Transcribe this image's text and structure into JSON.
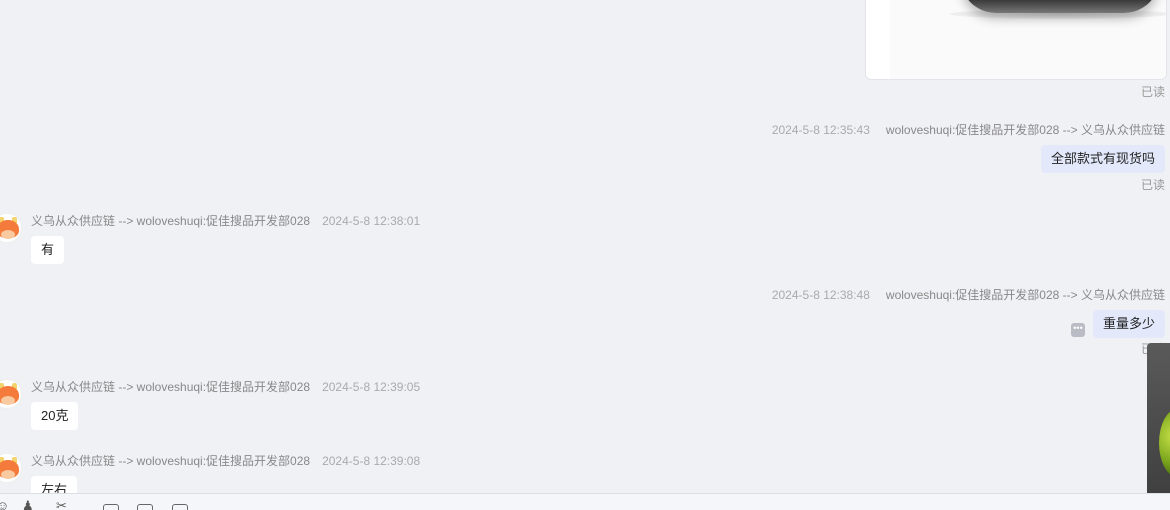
{
  "messages": {
    "m0": {
      "read": "已读"
    },
    "m1": {
      "time": "2024-5-8 12:35:43",
      "from_to": "woloveshuqi:促佳搜品开发部028 --> 义乌从众供应链",
      "text": "全部款式有现货吗",
      "read": "已读"
    },
    "m2": {
      "from_to": "义乌从众供应链 --> woloveshuqi:促佳搜品开发部028",
      "time": "2024-5-8 12:38:01",
      "text": "有"
    },
    "m3": {
      "time": "2024-5-8 12:38:48",
      "from_to": "woloveshuqi:促佳搜品开发部028 --> 义乌从众供应链",
      "text": "重量多少",
      "read": "已读"
    },
    "m4": {
      "from_to": "义乌从众供应链 --> woloveshuqi:促佳搜品开发部028",
      "time": "2024-5-8 12:39:05",
      "text": "20克"
    },
    "m5": {
      "from_to": "义乌从众供应链 --> woloveshuqi:促佳搜品开发部028",
      "time": "2024-5-8 12:39:08",
      "text": "左右"
    }
  },
  "icons": {
    "more": "more-icon",
    "toolbar": [
      "emoji-icon",
      "user-icon",
      "scissors-icon",
      "image-icon",
      "folder-icon",
      "chat-icon"
    ]
  },
  "colors": {
    "background": "#f0f1f5",
    "outgoing_bubble": "#e3e9fb",
    "incoming_bubble": "#ffffff"
  }
}
